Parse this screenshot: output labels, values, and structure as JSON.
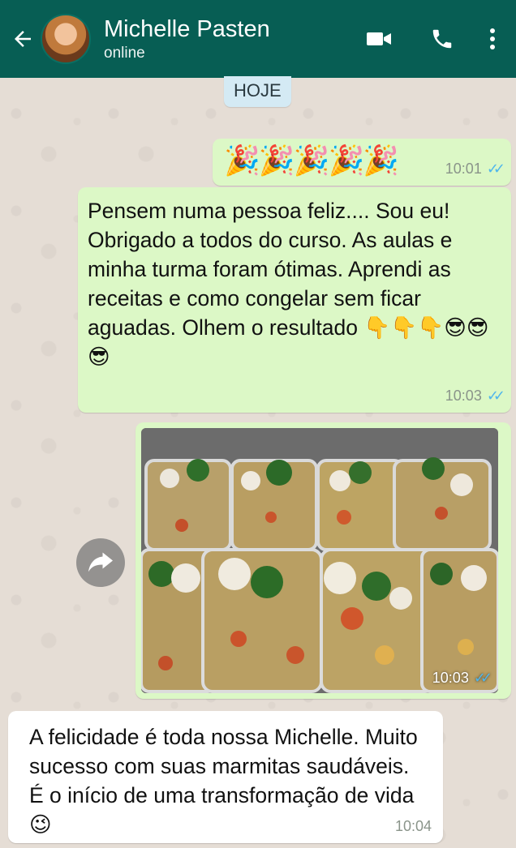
{
  "header": {
    "contact_name": "Michelle Pasten",
    "status": "online",
    "background": "#075e54",
    "icons": [
      "back-arrow-icon",
      "avatar",
      "video-call-icon",
      "phone-icon",
      "more-vert-icon"
    ]
  },
  "date_chip": "HOJE",
  "messages": [
    {
      "direction": "outgoing",
      "content": "🎉🎉🎉🎉🎉",
      "time": "10:01",
      "read": true
    },
    {
      "direction": "outgoing",
      "content": "Pensem numa pessoa feliz.... Sou eu! Obrigado a todos do curso. As aulas e minha turma foram ótimas. Aprendi as receitas e como congelar sem ficar aguadas. Olhem o resultado 👇👇👇😎😎😎",
      "time": "10:03",
      "read": true
    },
    {
      "direction": "outgoing",
      "type": "image",
      "image_description": "eight meal-prep containers with rice, vegetables, broccoli and cauliflower",
      "time": "10:03",
      "read": true
    },
    {
      "direction": "incoming",
      "content": "A felicidade é toda nossa Michelle. Muito sucesso com suas marmitas saudáveis. É o início de uma transformação de vida😉",
      "time": "10:04"
    }
  ],
  "colors": {
    "outgoing_bubble": "#dcf8c6",
    "incoming_bubble": "#ffffff",
    "read_ticks": "#4fb6ec"
  }
}
